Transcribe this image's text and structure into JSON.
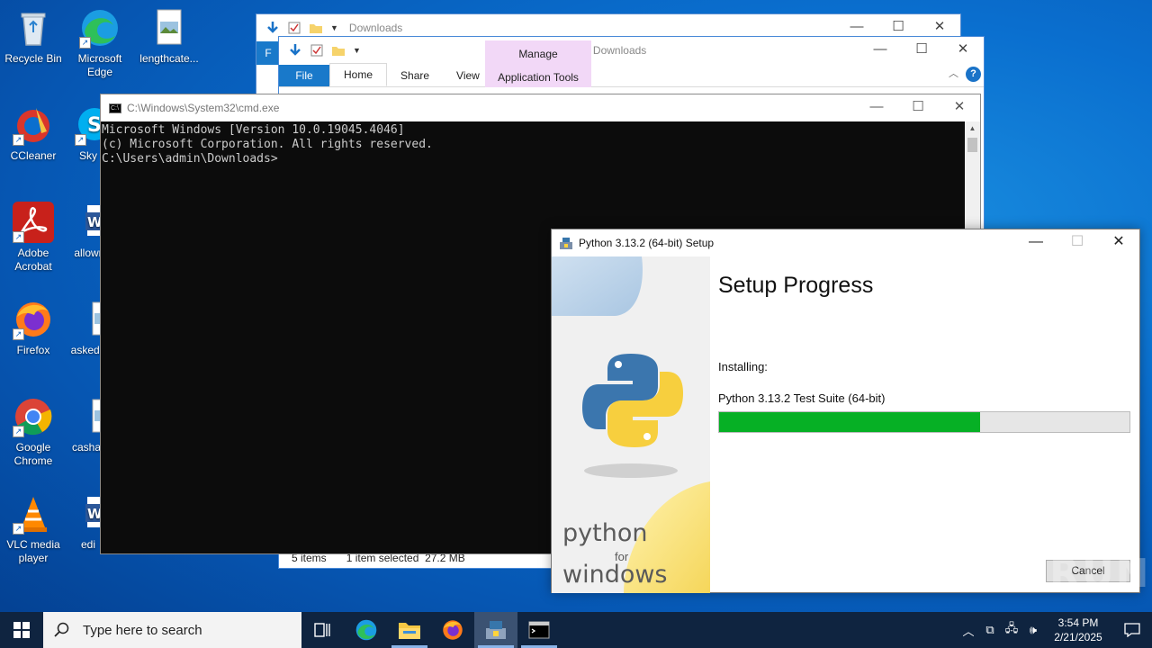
{
  "desktop": {
    "icons": [
      {
        "label": "Recycle Bin"
      },
      {
        "label": "Microsoft Edge"
      },
      {
        "label": "lengthcate..."
      },
      {
        "label": "CCleaner"
      },
      {
        "label": "Sky"
      },
      {
        "label": "Adobe Acrobat"
      },
      {
        "label": "allowr"
      },
      {
        "label": "Firefox"
      },
      {
        "label": "askeda"
      },
      {
        "label": "Google Chrome"
      },
      {
        "label": "cashar"
      },
      {
        "label": "VLC media player"
      },
      {
        "label": "edi"
      }
    ]
  },
  "explorer_back": {
    "title": "Downloads",
    "file_tab": "F"
  },
  "explorer": {
    "title": "Downloads",
    "tabs": {
      "file": "File",
      "home": "Home",
      "share": "Share",
      "view": "View"
    },
    "manage": "Manage",
    "app_tools": "Application Tools",
    "status_items": "5 items",
    "status_selected": "1 item selected  27.2 MB",
    "help": "?"
  },
  "cmd": {
    "title": "C:\\Windows\\System32\\cmd.exe",
    "lines": [
      "Microsoft Windows [Version 10.0.19045.4046]",
      "(c) Microsoft Corporation. All rights reserved.",
      "",
      "C:\\Users\\admin\\Downloads>"
    ]
  },
  "setup": {
    "title": "Python 3.13.2 (64-bit) Setup",
    "heading": "Setup Progress",
    "installing_label": "Installing:",
    "package": "Python 3.13.2 Test Suite (64-bit)",
    "progress_percent": 63.5,
    "cancel_label": "Cancel",
    "side_brand_1": "python",
    "side_brand_2": "for",
    "side_brand_3": "windows"
  },
  "watermark": "ANY RUN",
  "taskbar": {
    "search_placeholder": "Type here to search",
    "time": "3:54 PM",
    "date": "2/21/2025"
  },
  "colors": {
    "progress_fill": "#06b025",
    "taskbar": "#0f2440",
    "ribbon_file": "#1979ca",
    "manage_tab": "#f2d8f7"
  }
}
